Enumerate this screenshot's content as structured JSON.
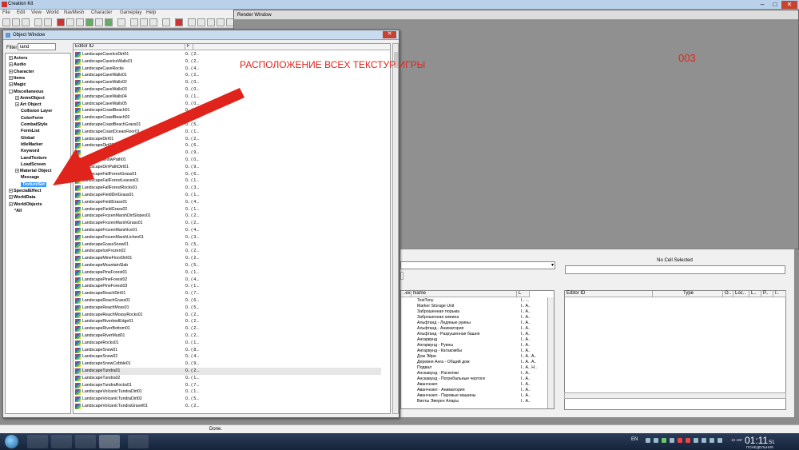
{
  "app": {
    "title": "Creation Kit"
  },
  "menu": [
    "File",
    "Edit",
    "View",
    "World",
    "NavMesh",
    "Character",
    "Gameplay",
    "Help"
  ],
  "render_window": {
    "title": "Render Window",
    "overlay_text": "003"
  },
  "object_window": {
    "title": "Object Window",
    "filter_label": "Filter",
    "filter_value": "land",
    "tree": [
      {
        "label": "Actors",
        "expander": "+"
      },
      {
        "label": "Audio",
        "expander": "+"
      },
      {
        "label": "Character",
        "expander": "+"
      },
      {
        "label": "Items",
        "expander": "+"
      },
      {
        "label": "Magic",
        "expander": "+"
      },
      {
        "label": "Miscellaneous",
        "expander": "-"
      },
      {
        "label": "AnimObject",
        "expander": "+"
      },
      {
        "label": "Art Object",
        "expander": "+"
      },
      {
        "label": "Collision Layer",
        "expander": ""
      },
      {
        "label": "ColorForm",
        "expander": ""
      },
      {
        "label": "CombatStyle",
        "expander": ""
      },
      {
        "label": "FormList",
        "expander": ""
      },
      {
        "label": "Global",
        "expander": ""
      },
      {
        "label": "IdleMarker",
        "expander": ""
      },
      {
        "label": "Keyword",
        "expander": ""
      },
      {
        "label": "LandTexture",
        "expander": ""
      },
      {
        "label": "LoadScreen",
        "expander": ""
      },
      {
        "label": "Material Object",
        "expander": "+"
      },
      {
        "label": "Message",
        "expander": ""
      },
      {
        "label": "TextureSet",
        "expander": ""
      },
      {
        "label": "SpecialEffect",
        "expander": "+"
      },
      {
        "label": "WorldData",
        "expander": "+"
      },
      {
        "label": "WorldObjects",
        "expander": "+"
      },
      {
        "label": "*All",
        "expander": ""
      }
    ],
    "list_headers": {
      "editor_id": "Editor ID",
      "f": "F"
    },
    "rows": [
      {
        "id": "LandscapeCaveIceDirt01",
        "f": "0.. ( 2..."
      },
      {
        "id": "LandscapeCaveIceWalls01",
        "f": "0.. ( 2..."
      },
      {
        "id": "LandscapeCaveRocks",
        "f": "0.. ( 4..."
      },
      {
        "id": "LandscapeCaveWalls01",
        "f": "0.. ( 2..."
      },
      {
        "id": "LandscapeCaveWalls02",
        "f": "0.. ( 0..."
      },
      {
        "id": "LandscapeCaveWalls03",
        "f": "0.. ( 0..."
      },
      {
        "id": "LandscapeCaveWalls04",
        "f": "0.. ( 1..."
      },
      {
        "id": "LandscapeCaveWalls05",
        "f": "0.. ( 0..."
      },
      {
        "id": "LandscapeCoastBeach01",
        "f": "0.. ( 2..."
      },
      {
        "id": "LandscapeCoastBeach02",
        "f": "0.. ( 2..."
      },
      {
        "id": "LandscapeCoastBeachGrass01",
        "f": "0.. ( 5..."
      },
      {
        "id": "LandscapeCoastOceanFloor01",
        "f": "0.. ( 1..."
      },
      {
        "id": "LandscapeDirt01",
        "f": "0.. ( 2..."
      },
      {
        "id": "LandscapeDirt02",
        "f": "0.. ( 6..."
      },
      {
        "id": "",
        "f": "0.. ( 9..."
      },
      {
        "id": "LandscapeSnowPath01",
        "f": "0.. ( 0..."
      },
      {
        "id": "LandscapeDirtPathDirt01",
        "f": "0.. ( 9..."
      },
      {
        "id": "LandscapeFallForestGrass01",
        "f": "0.. ( 6..."
      },
      {
        "id": "LandscapeFallForestLeaves01",
        "f": "0.. ( 1..."
      },
      {
        "id": "LandscapeFallForestRocks01",
        "f": "0.. ( 3..."
      },
      {
        "id": "LandscapeFieldDirtGrass01",
        "f": "0.. ( 1..."
      },
      {
        "id": "LandscapeFieldGrass01",
        "f": "0.. ( 4..."
      },
      {
        "id": "LandscapeFieldGrass02",
        "f": "0.. ( 1..."
      },
      {
        "id": "LandscapeFrozenMarshDirtSlopes01",
        "f": "0.. ( 2..."
      },
      {
        "id": "LandscapeFrozenMarshGrass01",
        "f": "0.. ( 2..."
      },
      {
        "id": "LandscapeFrozenMarshIce01",
        "f": "0.. ( 4..."
      },
      {
        "id": "LandscapeFrozenMarshLichen01",
        "f": "0.. ( 3..."
      },
      {
        "id": "LandscapeGrassSnow01",
        "f": "0.. ( 5..."
      },
      {
        "id": "LandscapeIceFrozen02",
        "f": "0.. ( 2..."
      },
      {
        "id": "LandscapeMineFloorDirt01",
        "f": "0.. ( 2..."
      },
      {
        "id": "LandscapeMountainSlab",
        "f": "0.. ( 5..."
      },
      {
        "id": "LandscapePineForest01",
        "f": "0.. ( 1..."
      },
      {
        "id": "LandscapePineForest02",
        "f": "0.. ( 4..."
      },
      {
        "id": "LandscapePineForest03",
        "f": "0.. ( 1..."
      },
      {
        "id": "LandscapeReachDirt01",
        "f": "0.. ( 7..."
      },
      {
        "id": "LandscapeReachGrass01",
        "f": "0.. ( 6..."
      },
      {
        "id": "LandscapeReachMoss01",
        "f": "0.. ( 5..."
      },
      {
        "id": "LandscapeReachMossyRocks01",
        "f": "0.. ( 2..."
      },
      {
        "id": "LandscapeRiverbedEdge01",
        "f": "0.. ( 2..."
      },
      {
        "id": "LandscapeRiverBottom01",
        "f": "0.. ( 2..."
      },
      {
        "id": "LandscapeRiverMud01",
        "f": "0.. ( 2..."
      },
      {
        "id": "LandscapeRocks01",
        "f": "0.. ( 1..."
      },
      {
        "id": "LandscapeSnow01",
        "f": "0.. ( 8..."
      },
      {
        "id": "LandscapeSnow02",
        "f": "0.. ( 4..."
      },
      {
        "id": "LandscapeSnowCobble01",
        "f": "0.. ( 9..."
      },
      {
        "id": "LandscapeTundra01",
        "f": "0.. ( 2..."
      },
      {
        "id": "LandscapeTundra02",
        "f": "0.. ( 1..."
      },
      {
        "id": "LandscapeTundraRocks01",
        "f": "0.. ( 7..."
      },
      {
        "id": "LandscapeVolcanicTundraDirt01",
        "f": "0.. ( 1..."
      },
      {
        "id": "LandscapeVolcanicTundraDirt02",
        "f": "0.. ( 5..."
      },
      {
        "id": "LandscapeVolcanicTundraGravel01",
        "f": "0.. ( 2..."
      }
    ]
  },
  "annotation": {
    "text": "РАСПОЛОЖЕНИЕ ВСЕХ ТЕКСТУР ИГРЫ",
    "color": "#e1241b"
  },
  "cell_view": {
    "no_cell": "No Cell Selected",
    "headers": {
      "name": "Name",
      "l": "L"
    },
    "ref_headers": {
      "editor_id": "Editor ID",
      "type": "Type",
      "o": "O..",
      "loc": "Loc..",
      "l": "L..",
      "p": "P..",
      "i": "I.."
    },
    "names": [
      {
        "name": "TestTony",
        "l": "I.. -.."
      },
      {
        "name": "Marker Storage Unit",
        "l": "I.. A.."
      },
      {
        "name": "Заброшенная тюрьма",
        "l": "I.. A.."
      },
      {
        "name": "Заброшенная хижина",
        "l": "I.. A.."
      },
      {
        "name": "Альфтанд - Ледяные руины",
        "l": "I.. A.."
      },
      {
        "name": "Альфтанд - Аниматория",
        "l": "I.. A.."
      },
      {
        "name": "Альфтанд - Разрушенная башня",
        "l": "I.. A.."
      },
      {
        "name": "Ангарвунд",
        "l": "I.. A.."
      },
      {
        "name": "Ангарвунд - Руины",
        "l": "I.. A.."
      },
      {
        "name": "Ангарвунд - Катакомбы",
        "l": "I.. A.."
      },
      {
        "name": "Дом Эйри",
        "l": "I.. A.. A.."
      },
      {
        "name": "Деревня Анга - Общий дом",
        "l": "I.. A.. A.."
      },
      {
        "name": "Подвал",
        "l": "I.. A.. H.."
      },
      {
        "name": "Анскавунд - Раскопки",
        "l": "I.. A.."
      },
      {
        "name": "Анскавунд - Погребальные чертоги",
        "l": "I.. A.."
      },
      {
        "name": "Аванчнзел",
        "l": "I.. A.."
      },
      {
        "name": "Аванчнзел - Аниматория",
        "l": "I.. A.."
      },
      {
        "name": "Аванчнзел - Паровые машины",
        "l": "I.. A.."
      },
      {
        "name": "Виоты Эверен Алары",
        "l": "I.. A.."
      }
    ]
  },
  "status": {
    "text": "Done."
  },
  "taskbar": {
    "lang": "EN",
    "time": "01:11",
    "seconds": ":51",
    "day": "ПОНЕДЕЛЬНИК",
    "date": "18 АВГ"
  }
}
